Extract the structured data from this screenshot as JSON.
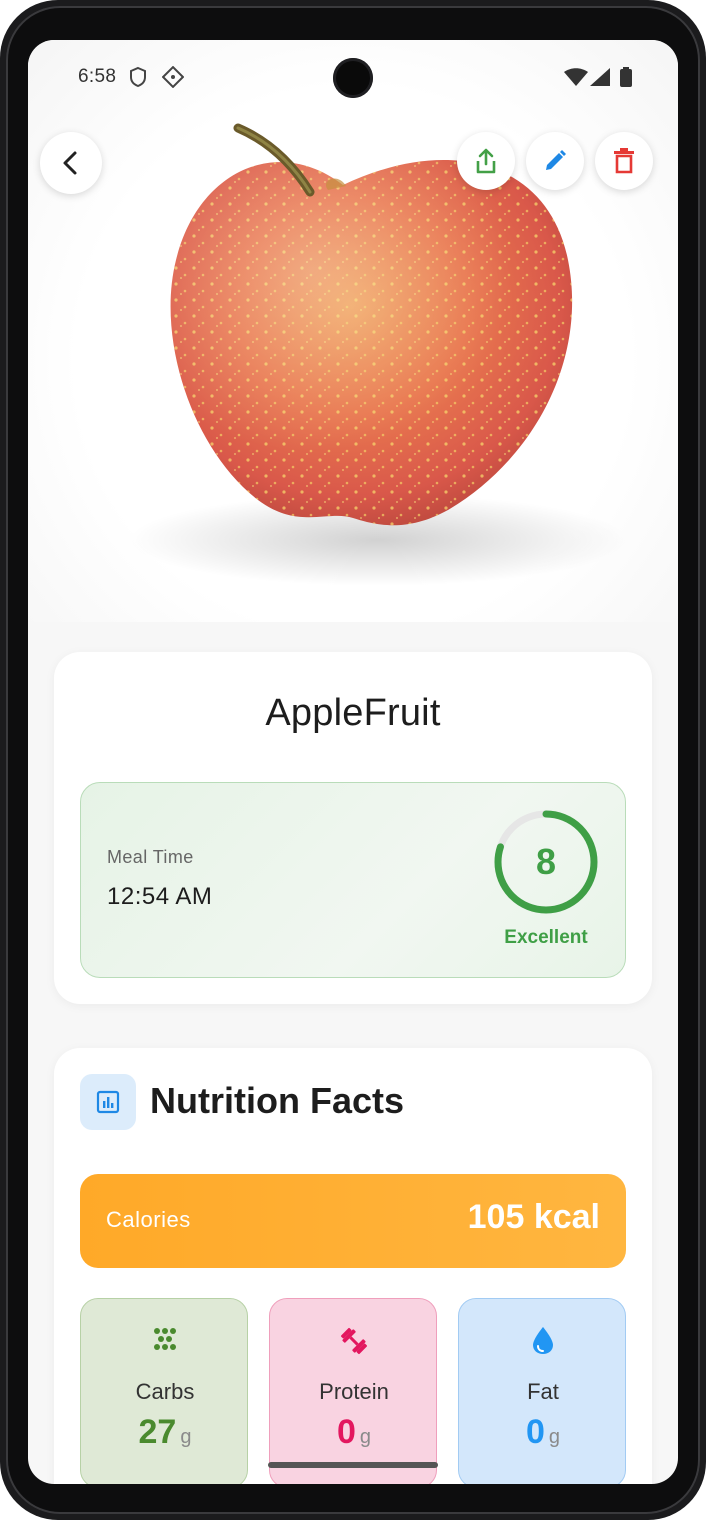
{
  "status_bar": {
    "time": "6:58",
    "icons": [
      "shield-icon",
      "dots-icon",
      "wifi-icon",
      "signal-icon",
      "battery-icon"
    ]
  },
  "header": {
    "actions": [
      "back-icon",
      "share-icon",
      "edit-icon",
      "delete-icon"
    ],
    "colors": {
      "share": "#43a047",
      "edit": "#1e88e5",
      "delete": "#e53935"
    }
  },
  "food": {
    "name": "AppleFruit",
    "meal_time_label": "Meal Time",
    "meal_time": "12:54 AM",
    "score": "8",
    "score_fraction": 0.8,
    "score_label": "Excellent"
  },
  "nutrition": {
    "title": "Nutrition Facts",
    "calories_label": "Calories",
    "calories_value": "105 kcal",
    "macros": [
      {
        "name": "Carbs",
        "value": "27",
        "unit": "g",
        "icon": "grain-icon",
        "color": "#4a8a2e"
      },
      {
        "name": "Protein",
        "value": "0",
        "unit": "g",
        "icon": "dumbbell-icon",
        "color": "#e3175f"
      },
      {
        "name": "Fat",
        "value": "0",
        "unit": "g",
        "icon": "water-drop-icon",
        "color": "#2196f3"
      }
    ]
  },
  "colors": {
    "accent_green": "#3f9f46",
    "calories_orange": "#ffa928"
  }
}
